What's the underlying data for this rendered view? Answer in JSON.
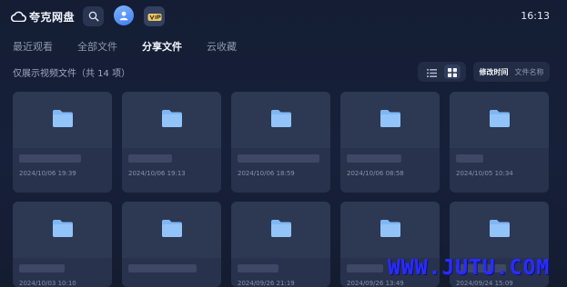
{
  "app": {
    "name": "夸克网盘",
    "time": "16:13"
  },
  "tabs": [
    {
      "label": "最近观看",
      "active": false
    },
    {
      "label": "全部文件",
      "active": false
    },
    {
      "label": "分享文件",
      "active": true
    },
    {
      "label": "云收藏",
      "active": false
    }
  ],
  "info": {
    "summary": "仅展示视频文件（共 14 项）"
  },
  "sort": {
    "options": [
      "修改时间",
      "文件名称"
    ],
    "selected": "修改时间"
  },
  "view": {
    "modes": [
      "list-icon",
      "grid-icon"
    ],
    "selected": "grid-icon"
  },
  "files": [
    {
      "date": "2024/10/06 19:39"
    },
    {
      "date": "2024/10/06 19:13"
    },
    {
      "date": "2024/10/06 18:59"
    },
    {
      "date": "2024/10/06 08:58"
    },
    {
      "date": "2024/10/05 10:34"
    },
    {
      "date": "2024/10/03 10:10"
    },
    {
      "date": ""
    },
    {
      "date": "2024/09/26 21:19"
    },
    {
      "date": "2024/09/26 13:49"
    },
    {
      "date": "2024/09/24 15:09"
    }
  ],
  "watermark": {
    "text": "WWW.JUTU.COM"
  },
  "colors": {
    "background": "#16203a",
    "card": "#28324c",
    "folder": "#7fb7f5",
    "watermark": "#2a2cff"
  }
}
